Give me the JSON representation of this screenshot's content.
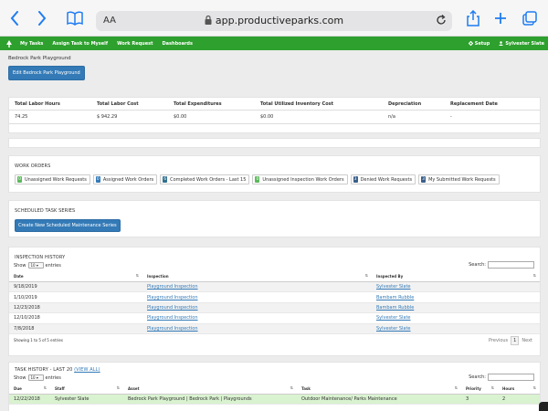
{
  "browser": {
    "text_size_label": "AA",
    "url": "app.productiveparks.com"
  },
  "navbar": {
    "items": [
      "My Tasks",
      "Assign Task to Myself",
      "Work Request",
      "Dashboards"
    ],
    "setup": "Setup",
    "user": "Sylvester Slate"
  },
  "page": {
    "title": "Bedrock Park Playground",
    "edit_button": "Edit Bedrock Park Playground"
  },
  "summary": {
    "headers": [
      "Total Labor Hours",
      "Total Labor Cost",
      "Total Expenditures",
      "Total Utilized Inventory Cost",
      "Depreciation",
      "Replacement Date"
    ],
    "values": [
      "74.25",
      "$ 942.29",
      "$0.00",
      "$0.00",
      "n/a",
      "-"
    ]
  },
  "work_orders": {
    "title": "WORK ORDERS",
    "items": [
      {
        "count": "0",
        "label": "Unassigned Work Requests",
        "color": "#5cb85c"
      },
      {
        "count": "0",
        "label": "Assigned Work Orders",
        "color": "#337ab7"
      },
      {
        "count": "6",
        "label": "Completed Work Orders - Last 15",
        "color": "#31708f"
      },
      {
        "count": "0",
        "label": "Unassigned Inspection Work Orders",
        "color": "#5cb85c"
      },
      {
        "count": "3",
        "label": "Denied Work Requests",
        "color": "#3a5f8a"
      },
      {
        "count": "3",
        "label": "My Submitted Work Requests",
        "color": "#3a5f8a"
      }
    ]
  },
  "scheduled": {
    "title": "SCHEDULED TASK SERIES",
    "button": "Create New Scheduled Maintenance Series"
  },
  "inspection": {
    "title": "INSPECTION HISTORY",
    "show": "Show",
    "entries_value": "10",
    "entries": "entries",
    "search": "Search:",
    "headers": [
      "Date",
      "Inspection",
      "Inspected By"
    ],
    "rows": [
      {
        "date": "9/18/2019",
        "inspection": "Playground Inspection",
        "by": "Sylvester Slate"
      },
      {
        "date": "1/10/2019",
        "inspection": "Playground Inspection",
        "by": "Bambam Rubble"
      },
      {
        "date": "12/23/2018",
        "inspection": "Playground Inspection",
        "by": "Bambam Rubble"
      },
      {
        "date": "12/10/2018",
        "inspection": "Playground Inspection",
        "by": "Sylvester Slate"
      },
      {
        "date": "7/8/2018",
        "inspection": "Playground Inspection",
        "by": "Sylvester Slate"
      }
    ],
    "showing": "Showing 1 to 5 of 5 entries",
    "previous": "Previous",
    "page": "1",
    "next": "Next"
  },
  "task_history": {
    "title": "TASK HISTORY - LAST 20",
    "view_all": "(VIEW ALL)",
    "show": "Show",
    "entries_value": "10",
    "entries": "entries",
    "search": "Search:",
    "headers": [
      "Due",
      "Staff",
      "Asset",
      "Task",
      "Priority",
      "Hours"
    ],
    "rows": [
      {
        "due": "12/22/2018",
        "staff": "Sylvester Slate",
        "asset": "Bedrock Park Playground | Bedrock Park | Playgrounds",
        "task": "Outdoor Maintenance/ Parks Maintenance",
        "priority": "3",
        "hours": "2"
      }
    ]
  }
}
